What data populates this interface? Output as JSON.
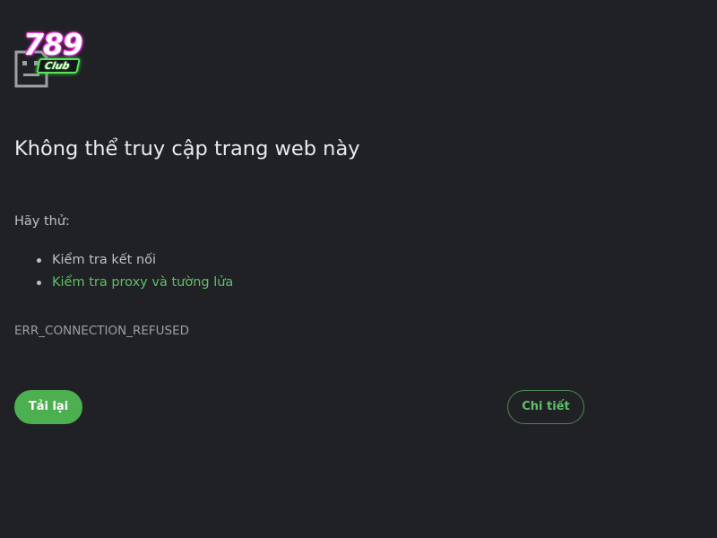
{
  "brand": {
    "logo_number": "789",
    "logo_word": "Club"
  },
  "error_icon": "broken-page-icon",
  "title": "Không thể truy cập trang web này",
  "suggestions": {
    "heading": "Hãy thử:",
    "items": [
      {
        "label": "Kiểm tra kết nối",
        "is_link": false
      },
      {
        "label": "Kiểm tra proxy và tường lửa",
        "is_link": true
      }
    ]
  },
  "error_code": "ERR_CONNECTION_REFUSED",
  "buttons": {
    "reload_label": "Tải lại",
    "details_label": "Chi tiết"
  },
  "colors": {
    "background": "#202124",
    "title_text": "#e8eaed",
    "body_text": "#bdc1c6",
    "muted_text": "#9aa0a6",
    "accent_green": "#4caf50",
    "link_green": "#5fbf6b"
  }
}
